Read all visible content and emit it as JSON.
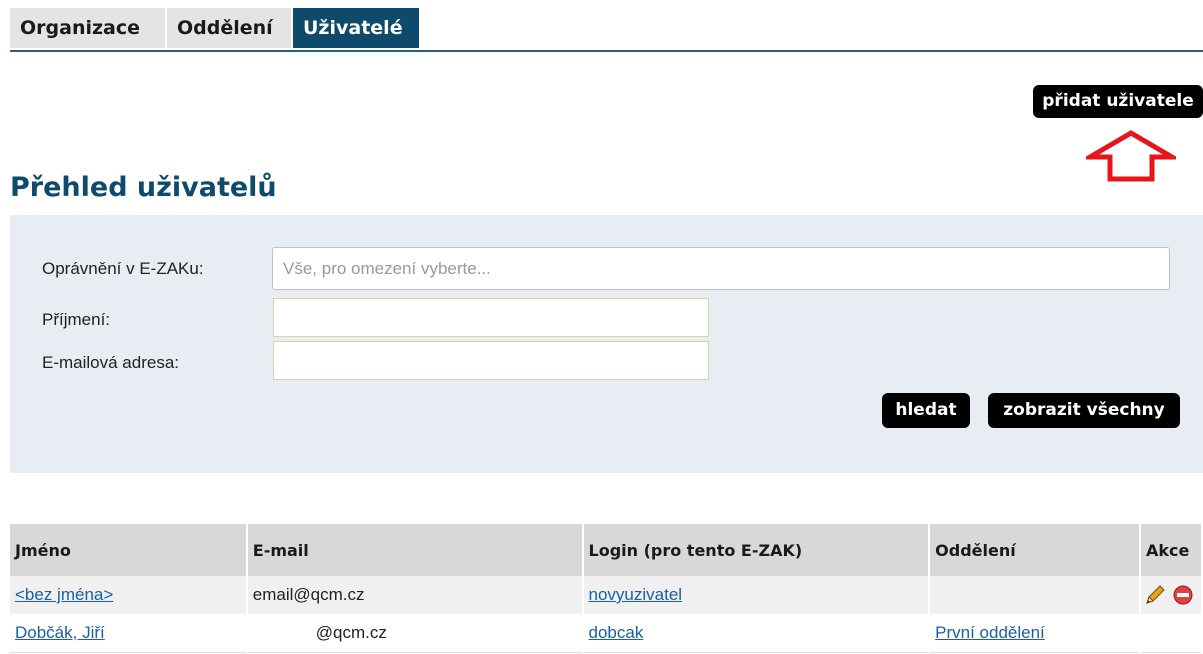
{
  "tabs": [
    {
      "label": "Organizace",
      "active": false
    },
    {
      "label": "Oddělení",
      "active": false
    },
    {
      "label": "Uživatelé",
      "active": true
    }
  ],
  "add_user_label": "přidat uživatele",
  "page_title": "Přehled uživatelů",
  "filter": {
    "permission_label": "Oprávnění v E-ZAKu:",
    "permission_placeholder": "Vše, pro omezení vyberte...",
    "surname_label": "Příjmení:",
    "surname_value": "",
    "email_label": "E-mailová adresa:",
    "email_value": "",
    "search_label": "hledat",
    "show_all_label": "zobrazit všechny"
  },
  "table": {
    "headers": [
      "Jméno",
      "E-mail",
      "Login (pro tento E-ZAK)",
      "Oddělení",
      "Akce"
    ],
    "rows": [
      {
        "name": "<bez jména>",
        "email": "email@qcm.cz",
        "login": "novyuzivatel",
        "department": "",
        "actions": [
          "pencil-icon",
          "delete-icon"
        ]
      },
      {
        "name": "Dobčák, Jiří",
        "email": "@qcm.cz",
        "login": "dobcak",
        "department": "První oddělení",
        "actions": []
      }
    ]
  },
  "colors": {
    "accent": "#0d4a6b",
    "filter_bg": "#e7edf3",
    "arrow": "#e8141a",
    "link": "#1a5fa8"
  }
}
